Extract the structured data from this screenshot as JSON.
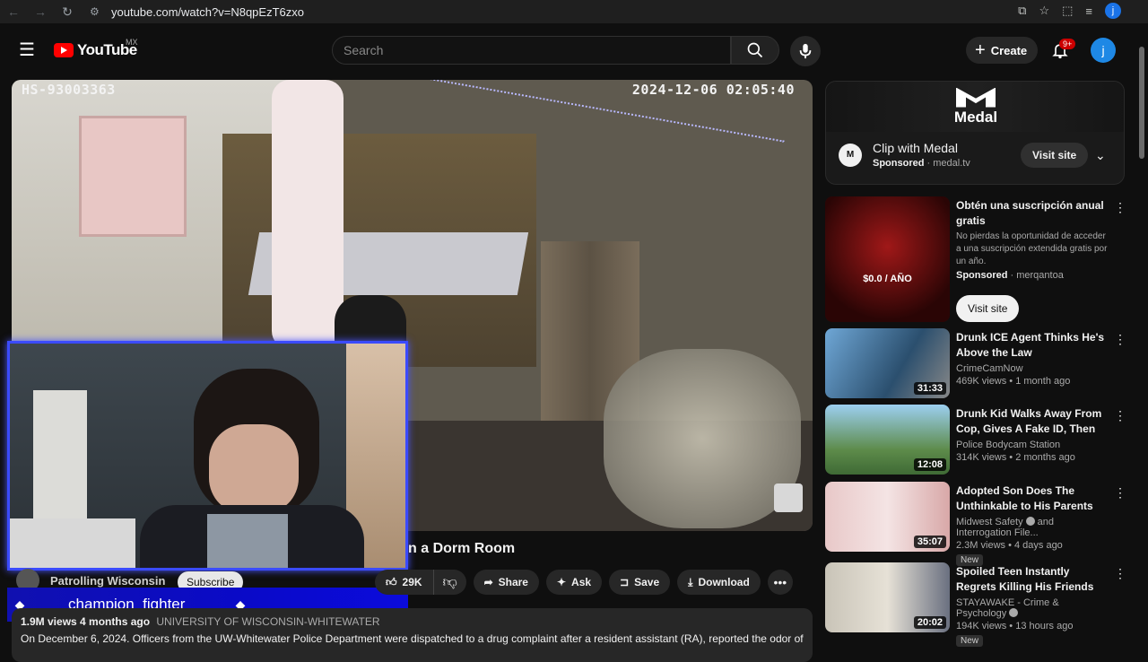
{
  "browser": {
    "url": "youtube.com/watch?v=N8qpEzT6zxo",
    "profile_initial": "j"
  },
  "header": {
    "logo_text": "YouTube",
    "country_code": "MX",
    "search_placeholder": "Search",
    "create_label": "Create",
    "notification_count": "9+",
    "avatar_initial": "j"
  },
  "player": {
    "camera_id": "HS-93003363",
    "timestamp": "2024-12-06  02:05:40"
  },
  "overlay": {
    "streamer_name": "champion_fighter"
  },
  "video": {
    "title_visible": "n a Dorm Room",
    "channel_name": "Patrolling Wisconsin",
    "subscribe_label": "Subscribe",
    "likes": "29K",
    "share_label": "Share",
    "ask_label": "Ask",
    "save_label": "Save",
    "download_label": "Download",
    "views_age": "1.9M views  4 months ago",
    "location_tag": "UNIVERSITY OF WISCONSIN-WHITEWATER",
    "description": "On December 6, 2024. Officers from the UW-Whitewater Police Department were dispatched to a drug complaint after a resident assistant (RA), reported the odor of"
  },
  "sidebar_ad": {
    "brand": "Medal",
    "title": "Clip with Medal",
    "sponsored": "Sponsored",
    "domain": "medal.tv",
    "visit_label": "Visit site"
  },
  "recommendations": [
    {
      "type": "ad",
      "title": "Obtén una suscripción anual gratis",
      "description": "No pierdas la oportunidad de acceder a una suscripción extendida gratis por un año.",
      "sponsored": "Sponsored",
      "advertiser": "merqantoa",
      "visit_label": "Visit site",
      "thumb_text": "$0.0 / AÑO"
    },
    {
      "type": "video",
      "title": "Drunk ICE Agent Thinks He's Above the Law",
      "channel": "CrimeCamNow",
      "meta": "469K views • 1 month ago",
      "duration": "31:33",
      "verified": false,
      "new": false
    },
    {
      "type": "video",
      "title": "Drunk Kid Walks Away From Cop, Gives A Fake ID, Then Tri...",
      "channel": "Police Bodycam Station",
      "meta": "314K views • 2 months ago",
      "duration": "12:08",
      "verified": false,
      "new": false
    },
    {
      "type": "video",
      "title": "Adopted Son Does The Unthinkable to His Parents",
      "channel": "Midwest Safety",
      "channel_suffix": "and Interrogation File...",
      "meta": "2.3M views • 4 days ago",
      "duration": "35:07",
      "verified": true,
      "new": true,
      "new_label": "New"
    },
    {
      "type": "video",
      "title": "Spoiled Teen Instantly Regrets Killing His Friends",
      "channel": "STAYAWAKE - Crime & Psychology",
      "meta": "194K views • 13 hours ago",
      "duration": "20:02",
      "verified": true,
      "new": true,
      "new_label": "New"
    }
  ],
  "colors": {
    "background": "#0f0f0f",
    "accent_red": "#ff0000",
    "overlay_blue": "#3b4bff",
    "chip": "#272727"
  }
}
